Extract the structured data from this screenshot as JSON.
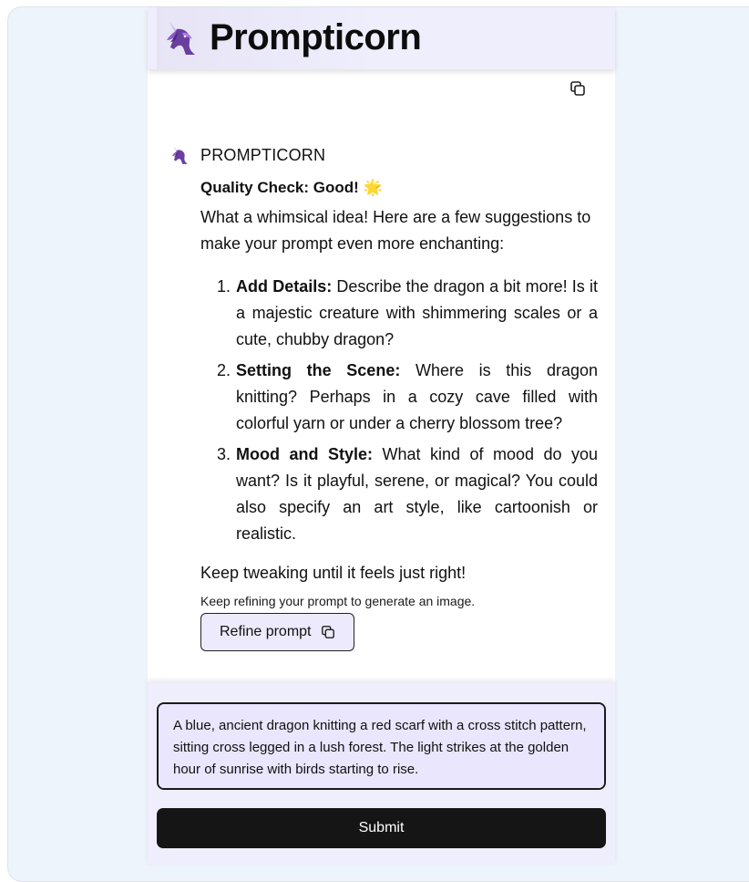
{
  "header": {
    "title": "Prompticorn",
    "logo_icon": "unicorn-icon"
  },
  "toolbar": {
    "copy_icon": "copy-icon"
  },
  "message": {
    "author": "PROMPTICORN",
    "quality_label": "Quality Check: Good!",
    "quality_emoji": "🌟",
    "intro": "What a whimsical idea! Here are a few suggestions to make your prompt even more enchanting:",
    "suggestions": [
      {
        "title": "Add Details:",
        "text": " Describe the dragon a bit more! Is it a majestic creature with shimmering scales or a cute, chubby dragon?"
      },
      {
        "title": "Setting the Scene:",
        "text": " Where is this dragon knitting? Perhaps in a cozy cave filled with colorful yarn or under a cherry blossom tree?"
      },
      {
        "title": "Mood and Style:",
        "text": " What kind of mood do you want? Is it playful, serene, or magical? You could also specify an art style, like cartoonish or realistic."
      }
    ],
    "outro": "Keep tweaking until it feels just right!",
    "hint": "Keep refining your prompt to generate an image.",
    "refine_label": "Refine prompt"
  },
  "composer": {
    "prompt_value": "A blue, ancient dragon knitting a red scarf with a cross stitch pattern, sitting cross legged in a lush forest. The light strikes at the golden hour of sunrise with birds starting to rise.",
    "submit_label": "Submit"
  },
  "colors": {
    "header_bg": "#efeefd",
    "page_bg": "#eef4fb",
    "accent_purple": "#6b3fa0",
    "button_dark": "#151515"
  }
}
